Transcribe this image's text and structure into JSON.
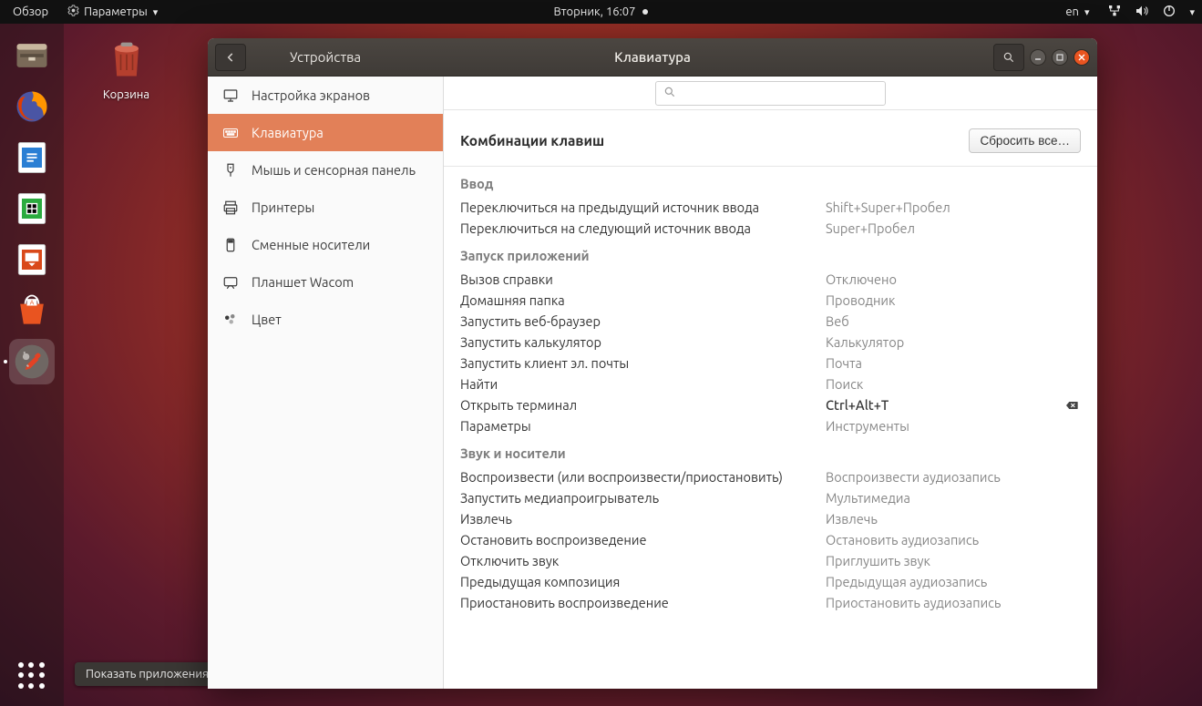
{
  "top_panel": {
    "activities": "Обзор",
    "app_menu": "Параметры",
    "clock": "Вторник, 16:07",
    "input_lang": "en"
  },
  "desktop": {
    "trash_label": "Корзина"
  },
  "tooltip": {
    "apps": "Показать приложения"
  },
  "window": {
    "back_panel": "Устройства",
    "title": "Клавиатура",
    "search_placeholder": "",
    "heading": "Комбинации клавиш",
    "reset_btn": "Сбросить все…"
  },
  "sidebar": {
    "items": [
      {
        "label": "Настройка экранов"
      },
      {
        "label": "Клавиатура"
      },
      {
        "label": "Мышь и сенсорная панель"
      },
      {
        "label": "Принтеры"
      },
      {
        "label": "Сменные носители"
      },
      {
        "label": "Планшет Wacom"
      },
      {
        "label": "Цвет"
      }
    ]
  },
  "shortcuts": {
    "groups": [
      {
        "name": "Ввод",
        "rows": [
          {
            "action": "Переключиться на предыдущий источник ввода",
            "key": "Shift+Super+Пробел"
          },
          {
            "action": "Переключиться на следующий источник ввода",
            "key": "Super+Пробел"
          }
        ]
      },
      {
        "name": "Запуск приложений",
        "rows": [
          {
            "action": "Вызов справки",
            "key": "Отключено"
          },
          {
            "action": "Домашняя папка",
            "key": "Проводник"
          },
          {
            "action": "Запустить веб-браузер",
            "key": "Веб"
          },
          {
            "action": "Запустить калькулятор",
            "key": "Калькулятор"
          },
          {
            "action": "Запустить клиент эл. почты",
            "key": "Почта"
          },
          {
            "action": "Найти",
            "key": "Поиск"
          },
          {
            "action": "Открыть терминал",
            "key": "Ctrl+Alt+T",
            "removable": true,
            "strong": true
          },
          {
            "action": "Параметры",
            "key": "Инструменты"
          }
        ]
      },
      {
        "name": "Звук и носители",
        "rows": [
          {
            "action": "Воспроизвести (или воспроизвести/приостановить)",
            "key": "Воспроизвести аудиозапись"
          },
          {
            "action": "Запустить медиапроигрыватель",
            "key": "Мультимедиа"
          },
          {
            "action": "Извлечь",
            "key": "Извлечь"
          },
          {
            "action": "Остановить воспроизведение",
            "key": "Остановить аудиозапись"
          },
          {
            "action": "Отключить звук",
            "key": "Приглушить звук"
          },
          {
            "action": "Предыдущая композиция",
            "key": "Предыдущая аудиозапись"
          },
          {
            "action": "Приостановить воспроизведение",
            "key": "Приостановить аудиозапись"
          }
        ]
      }
    ]
  }
}
